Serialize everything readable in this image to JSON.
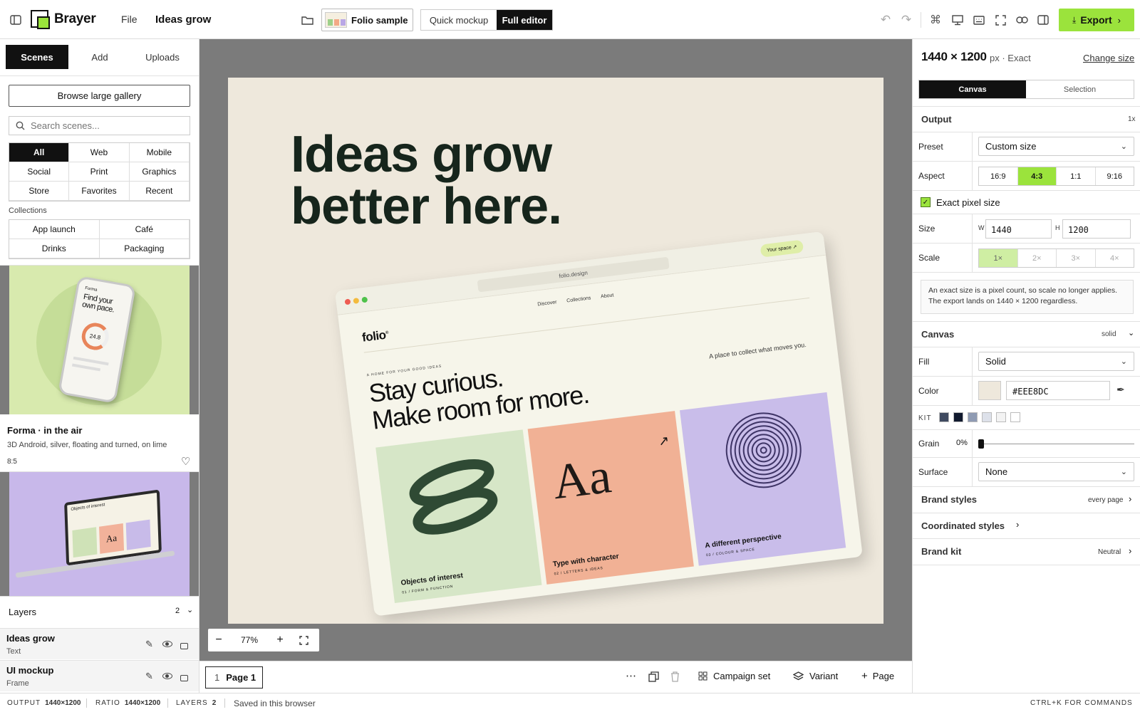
{
  "app": {
    "name": "Brayer",
    "file_menu": "File",
    "doc_title": "Ideas grow"
  },
  "toolbar": {
    "sample_label": "Folio sample",
    "mode_quick": "Quick mockup",
    "mode_full": "Full editor",
    "export_label": "Export"
  },
  "left": {
    "tabs": [
      "Scenes",
      "Add",
      "Uploads"
    ],
    "browse_label": "Browse large gallery",
    "search_placeholder": "Search scenes...",
    "filters": [
      "All",
      "Web",
      "Mobile",
      "Social",
      "Print",
      "Graphics",
      "Store",
      "Favorites",
      "Recent"
    ],
    "collections_label": "Collections",
    "collections": [
      "App launch",
      "Café",
      "Drinks",
      "Packaging"
    ],
    "scene1": {
      "title": "Forma · in the air",
      "desc": "3D Android, silver, floating and turned, on lime",
      "ratio": "8:5",
      "phone_heading": "Find your own pace.",
      "phone_brand": "Forma",
      "phone_value": "24.8"
    },
    "scene2": {
      "screen_text": "Objects of interest",
      "tile_text": "Aa"
    },
    "layers": {
      "label": "Layers",
      "count": "2",
      "items": [
        {
          "name": "Ideas grow",
          "type": "Text"
        },
        {
          "name": "UI mockup",
          "type": "Frame"
        }
      ]
    }
  },
  "canvas": {
    "headline_line1": "Ideas grow",
    "headline_line2": "better here.",
    "zoom": "77%",
    "mockup": {
      "url": "folio.design",
      "cta": "Your space ↗",
      "nav": [
        "Discover",
        "Collections",
        "About"
      ],
      "logo": "folio",
      "logo_mark": "®",
      "eyebrow": "A HOME FOR YOUR GOOD IDEAS",
      "hero_line1": "Stay curious.",
      "hero_line2": "Make room for more.",
      "tagline": "A place to collect what moves you.",
      "cards": [
        {
          "title": "Objects of interest",
          "sub": "01 / FORM & FUNCTION"
        },
        {
          "title": "Type with character",
          "sub": "02 / LETTERS & IDEAS",
          "glyph": "Aa",
          "arrow": "↗"
        },
        {
          "title": "A different perspective",
          "sub": "03 / COLOUR & SPACE"
        }
      ]
    }
  },
  "pagebar": {
    "page_num": "1",
    "page_label": "Page 1",
    "campaign": "Campaign set",
    "variant": "Variant",
    "add_page": "Page"
  },
  "right": {
    "dims": "1440 × 1200",
    "dims_unit": "px · Exact",
    "change_size": "Change size",
    "tabs": [
      "Canvas",
      "Selection"
    ],
    "output_label": "Output",
    "output_scale": "1x",
    "preset_label": "Preset",
    "preset_value": "Custom size",
    "aspect_label": "Aspect",
    "aspects": [
      "16:9",
      "4:3",
      "1:1",
      "9:16"
    ],
    "exact_label": "Exact pixel size",
    "size_label": "Size",
    "w_label": "W",
    "w_value": "1440",
    "h_label": "H",
    "h_value": "1200",
    "scale_label": "Scale",
    "scales": [
      "1×",
      "2×",
      "3×",
      "4×"
    ],
    "note": "An exact size is a pixel count, so scale no longer applies. The export lands on 1440 × 1200 regardless.",
    "canvas_label": "Canvas",
    "canvas_mode": "solid",
    "fill_label": "Fill",
    "fill_value": "Solid",
    "color_label": "Color",
    "color_value": "#EEE8DC",
    "kit_label": "KIT",
    "kit_colors": [
      "#3f4a60",
      "#111a2e",
      "#8f9bb3",
      "#dde1ea",
      "#f3f3f3",
      "#ffffff"
    ],
    "grain_label": "Grain",
    "grain_value": "0%",
    "surface_label": "Surface",
    "surface_value": "None",
    "brand_styles": "Brand styles",
    "brand_styles_meta": "every page",
    "coordinated": "Coordinated styles",
    "brand_kit": "Brand kit",
    "brand_kit_meta": "Neutral"
  },
  "status": {
    "output_key": "OUTPUT",
    "output_val": "1440×1200",
    "ratio_key": "RATIO",
    "ratio_val": "1440×1200",
    "layers_key": "LAYERS",
    "layers_val": "2",
    "saved": "Saved in this browser",
    "hint": "CTRL+K FOR COMMANDS"
  },
  "colors": {
    "accent": "#9be33c",
    "dark": "#111111",
    "canvas_bg": "#EEE8DC",
    "stage_bg": "#7b7b7b"
  }
}
